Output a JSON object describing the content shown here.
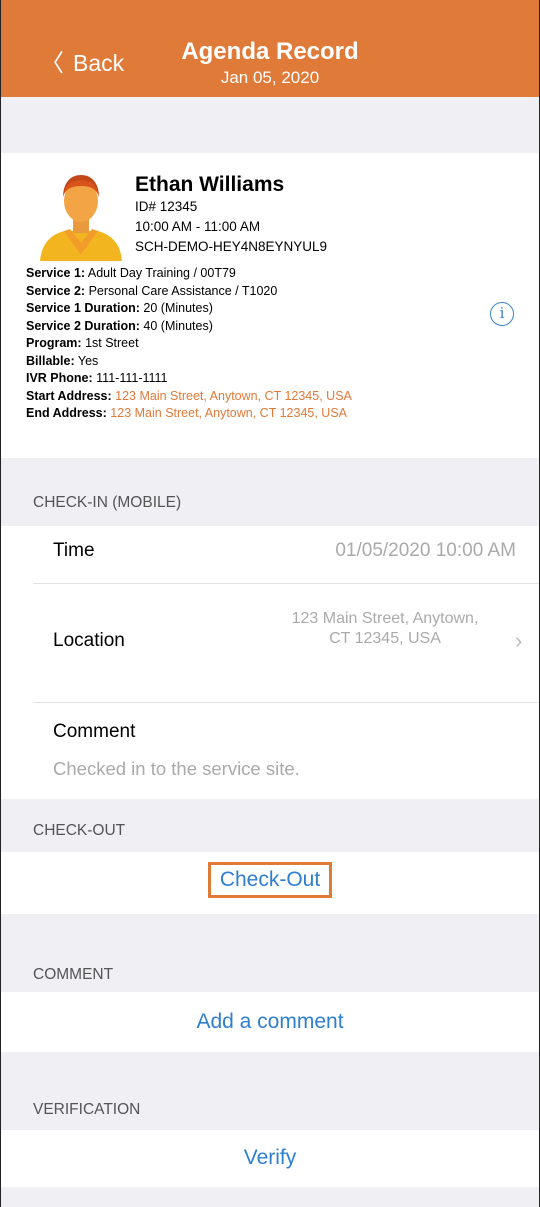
{
  "header": {
    "back_label": "Back",
    "title": "Agenda Record",
    "date": "Jan 05, 2020",
    "back_icon": "chevron-left-icon",
    "color": "#e07a39"
  },
  "client": {
    "avatar_icon": "person-avatar-icon",
    "name": "Ethan Williams",
    "id": "ID# 12345",
    "time": "10:00 AM - 11:00 AM",
    "schedule": "SCH-DEMO-HEY4N8EYNYUL9",
    "details": [
      {
        "label": "Service 1:",
        "value": "Adult Day Training / 00T79"
      },
      {
        "label": "Service 2:",
        "value": "Personal Care Assistance / T1020"
      },
      {
        "label": "Service 1 Duration:",
        "value": "20 (Minutes)"
      },
      {
        "label": "Service 2 Duration:",
        "value": "40 (Minutes)"
      },
      {
        "label": "Program:",
        "value": "1st Street"
      },
      {
        "label": "Billable:",
        "value": "Yes"
      },
      {
        "label": "IVR Phone:",
        "value": "111-111-1111"
      }
    ],
    "start_address_label": "Start Address:",
    "start_address": "123 Main Street, Anytown, CT 12345, USA",
    "end_address_label": "End Address:",
    "end_address": "123 Main Street, Anytown, CT 12345, USA",
    "info_icon": "info-icon"
  },
  "checkin": {
    "section": "CHECK-IN (MOBILE)",
    "time_label": "Time",
    "time_value": "01/05/2020 10:00 AM",
    "location_label": "Location",
    "location_line1": "123 Main Street, Anytown,",
    "location_line2": "CT 12345, USA",
    "comment_label": "Comment",
    "comment_value": "Checked in to the service site."
  },
  "checkout": {
    "section": "CHECK-OUT",
    "button": "Check-Out"
  },
  "comment": {
    "section": "COMMENT",
    "button": "Add a comment"
  },
  "verification": {
    "section": "VERIFICATION",
    "button": "Verify"
  },
  "colors": {
    "accent": "#e07a39",
    "link": "#2f7fd1",
    "background": "#efeff4"
  }
}
